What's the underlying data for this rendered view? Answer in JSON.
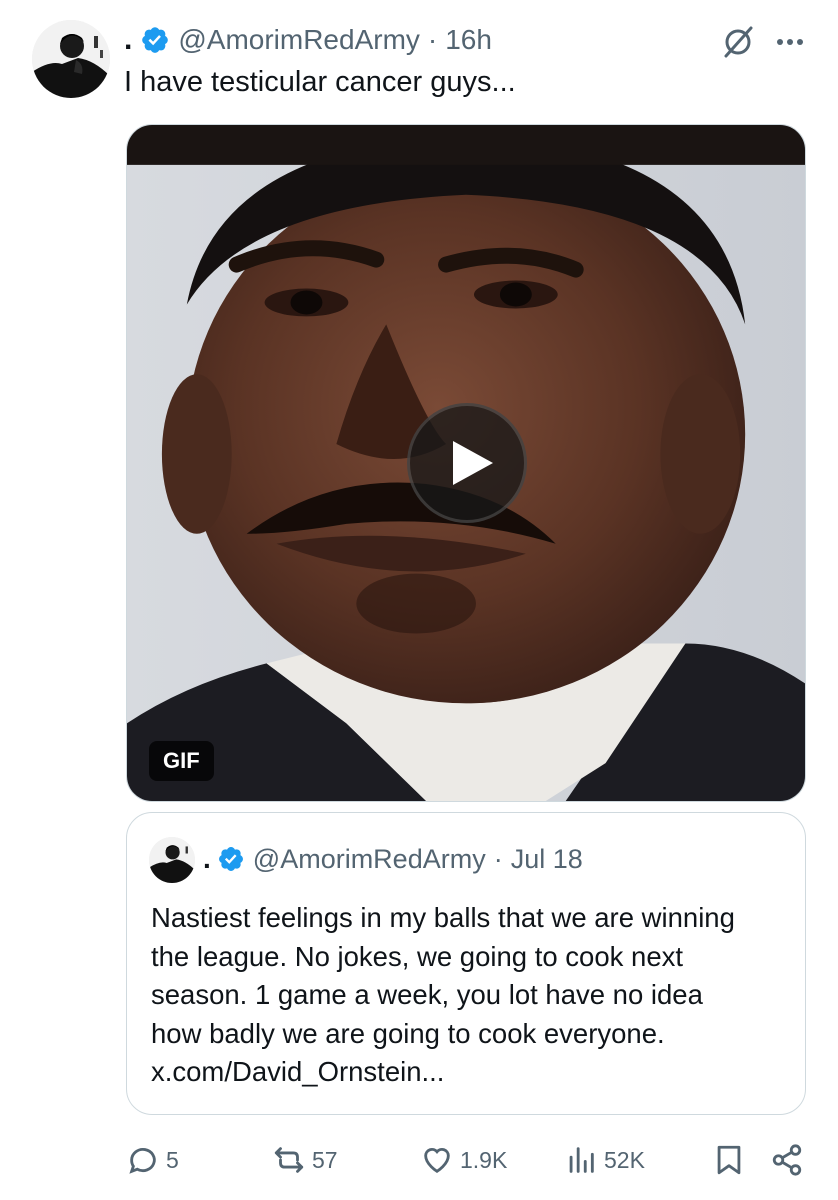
{
  "tweet": {
    "display_name": ".",
    "handle": "@AmorimRedArmy",
    "separator": "·",
    "time": "16h",
    "text": "I have testicular cancer guys..."
  },
  "media": {
    "badge": "GIF",
    "play_icon": "play-icon"
  },
  "quote": {
    "display_name": ".",
    "handle": "@AmorimRedArmy",
    "separator": "·",
    "time": "Jul 18",
    "lines": [
      "Nastiest feelings in my balls that we are winning",
      "the league. No jokes, we going to cook next",
      "season. 1 game a week, you lot have no idea",
      "how badly we are going to cook everyone.",
      "x.com/David_Ornstein..."
    ]
  },
  "actions": {
    "replies": "5",
    "reposts": "57",
    "likes": "1.9K",
    "views": "52K"
  },
  "icons": {
    "verified": "verified-badge-icon",
    "grok": "grok-icon",
    "more": "more-icon",
    "reply": "reply-icon",
    "repost": "repost-icon",
    "like": "heart-icon",
    "views": "views-icon",
    "bookmark": "bookmark-icon",
    "share": "share-icon"
  },
  "colors": {
    "verified_blue": "#1d9bf0",
    "text_primary": "#0f1419",
    "text_secondary": "#536471",
    "border": "#cfd9de"
  }
}
